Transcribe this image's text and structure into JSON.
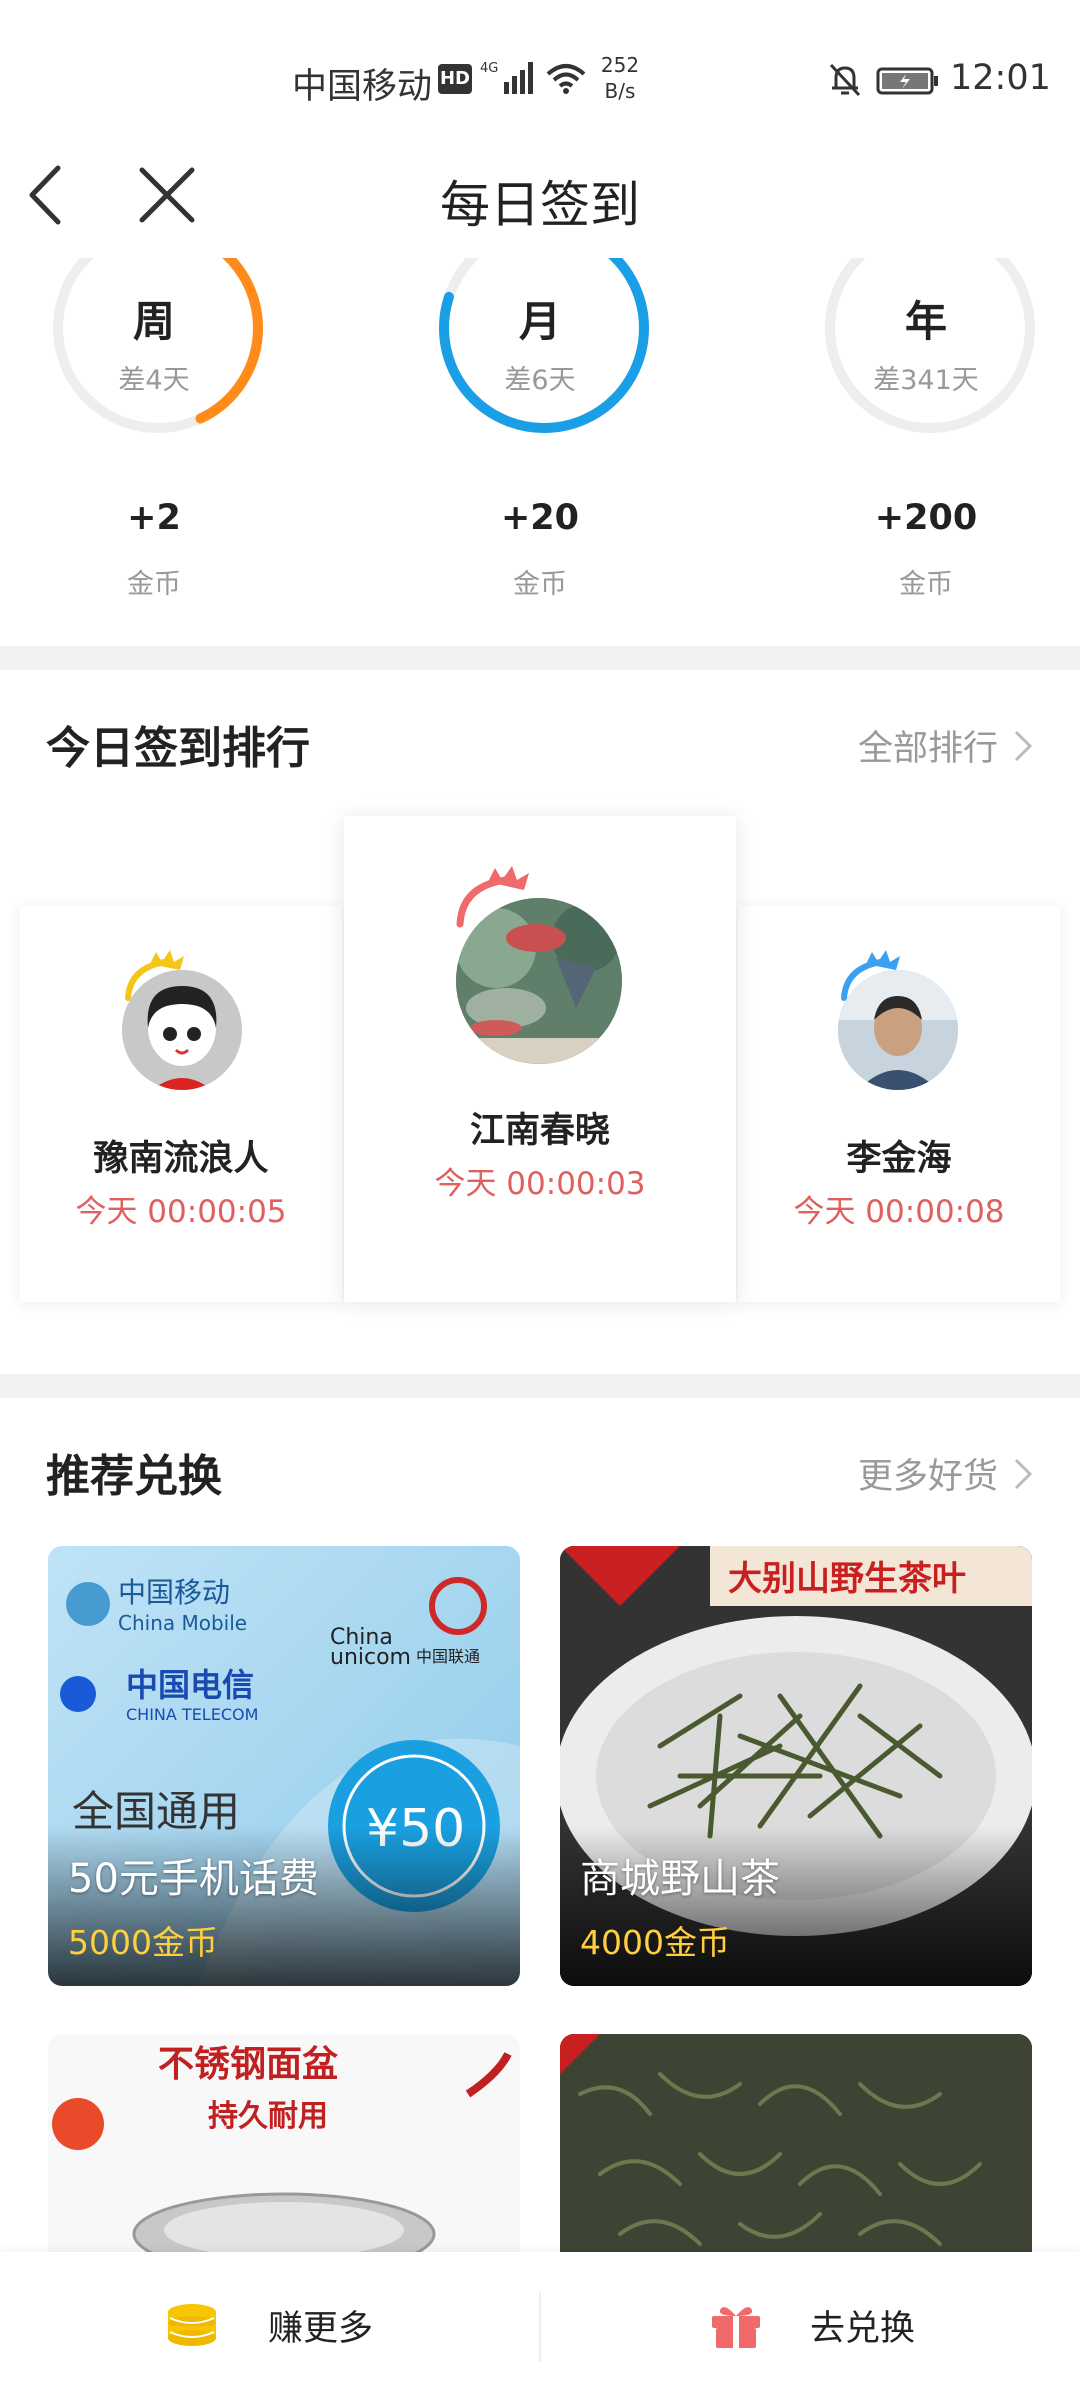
{
  "status_bar": {
    "carrier": "中国移动",
    "hd": "HD",
    "network": "4G",
    "speed_value": "252",
    "speed_unit": "B/s",
    "time": "12:01"
  },
  "nav": {
    "title": "每日签到"
  },
  "rings": [
    {
      "label": "周",
      "sub": "差4天",
      "reward": "+2",
      "unit": "金币",
      "progress": 0.43,
      "color": "#ff8c1a"
    },
    {
      "label": "月",
      "sub": "差6天",
      "reward": "+20",
      "unit": "金币",
      "progress": 0.8,
      "color": "#1a9fe6"
    },
    {
      "label": "年",
      "sub": "差341天",
      "reward": "+200",
      "unit": "金币",
      "progress": 0.07,
      "color": "#e8e8e8"
    }
  ],
  "ranking": {
    "title": "今日签到排行",
    "more": "全部排行",
    "items": [
      {
        "name": "豫南流浪人",
        "time": "今天 00:00:05"
      },
      {
        "name": "江南春晓",
        "time": "今天 00:00:03"
      },
      {
        "name": "李金海",
        "time": "今天 00:00:08"
      }
    ]
  },
  "recommend": {
    "title": "推荐兑换",
    "more": "更多好货",
    "items": [
      {
        "name": "50元手机话费",
        "price": "5000金币",
        "img_texts": [
          "中国移动",
          "China Mobile",
          "中国电信",
          "CHINA TELECOM",
          "China",
          "unicom",
          "中国联通",
          "全国通用",
          "¥50"
        ]
      },
      {
        "name": "商城野山茶",
        "price": "4000金币",
        "img_texts": [
          "大别山野生茶叶"
        ]
      },
      {
        "name": "",
        "price": "",
        "img_texts": [
          "不锈钢面盆",
          "持久耐用"
        ]
      },
      {
        "name": "",
        "price": "",
        "img_texts": []
      }
    ]
  },
  "bottom_bar": {
    "earn": "赚更多",
    "exchange": "去兑换"
  },
  "colors": {
    "week_ring": "#ff8c1a",
    "month_ring": "#1a9fe6",
    "rank_time": "#e06060",
    "price": "#ffcf40"
  }
}
